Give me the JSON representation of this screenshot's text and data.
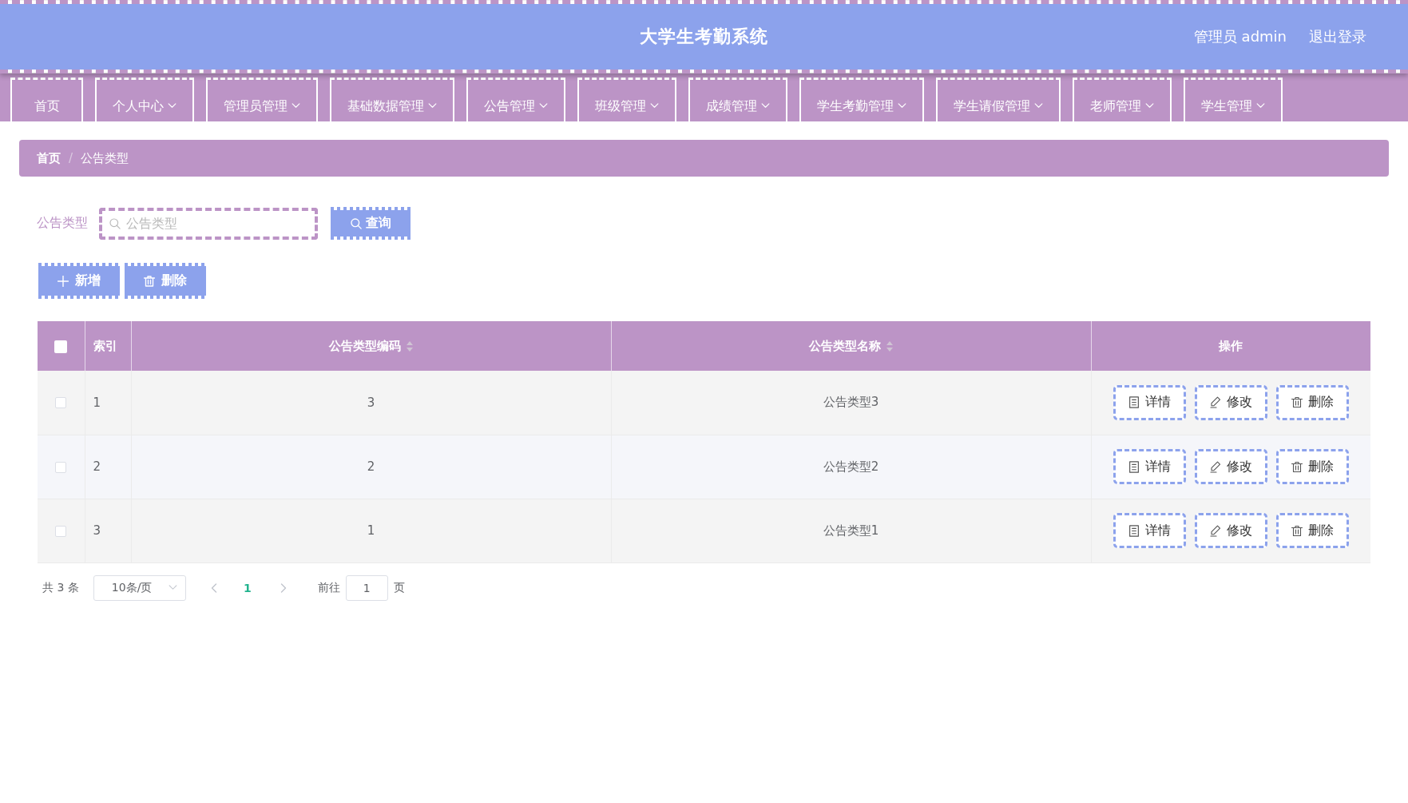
{
  "header": {
    "title": "大学生考勤系统",
    "user": "管理员 admin",
    "logout": "退出登录"
  },
  "nav": [
    {
      "label": "首页",
      "kind": "link"
    },
    {
      "label": "个人中心",
      "kind": "menu"
    },
    {
      "label": "管理员管理",
      "kind": "menu"
    },
    {
      "label": "基础数据管理",
      "kind": "menu"
    },
    {
      "label": "公告管理",
      "kind": "menu"
    },
    {
      "label": "班级管理",
      "kind": "menu"
    },
    {
      "label": "成绩管理",
      "kind": "menu"
    },
    {
      "label": "学生考勤管理",
      "kind": "menu"
    },
    {
      "label": "学生请假管理",
      "kind": "menu"
    },
    {
      "label": "老师管理",
      "kind": "menu"
    },
    {
      "label": "学生管理",
      "kind": "menu"
    }
  ],
  "breadcrumb": {
    "separator": "/",
    "items": [
      {
        "label": "首页",
        "kind": "link"
      },
      {
        "label": "公告类型",
        "kind": "current"
      }
    ]
  },
  "search": {
    "label": "公告类型",
    "placeholder": "公告类型",
    "button": "查询"
  },
  "toolbar": [
    {
      "label": "新增",
      "kind": "add"
    },
    {
      "label": "删除",
      "kind": "delete"
    }
  ],
  "table": {
    "select_all_checked": false,
    "columns": [
      {
        "label": "索引",
        "sortable": false
      },
      {
        "label": "公告类型编码",
        "sortable": true
      },
      {
        "label": "公告类型名称",
        "sortable": true
      },
      {
        "label": "操作",
        "sortable": false
      }
    ],
    "rows": [
      {
        "checked": false,
        "index": "1",
        "code": "3",
        "name": "公告类型3",
        "actions": [
          {
            "label": "详情",
            "kind": "detail"
          },
          {
            "label": "修改",
            "kind": "edit"
          },
          {
            "label": "删除",
            "kind": "delete"
          }
        ]
      },
      {
        "checked": false,
        "index": "2",
        "code": "2",
        "name": "公告类型2",
        "actions": [
          {
            "label": "详情",
            "kind": "detail"
          },
          {
            "label": "修改",
            "kind": "edit"
          },
          {
            "label": "删除",
            "kind": "delete"
          }
        ]
      },
      {
        "checked": false,
        "index": "3",
        "code": "1",
        "name": "公告类型1",
        "actions": [
          {
            "label": "详情",
            "kind": "detail"
          },
          {
            "label": "修改",
            "kind": "edit"
          },
          {
            "label": "删除",
            "kind": "delete"
          }
        ]
      }
    ]
  },
  "pagination": {
    "total": "共 3 条",
    "page_size": "10条/页",
    "pages": [
      {
        "label": "1",
        "selected": true
      }
    ],
    "goto_label": "前往",
    "goto_value": "1",
    "goto_suffix": "页"
  }
}
